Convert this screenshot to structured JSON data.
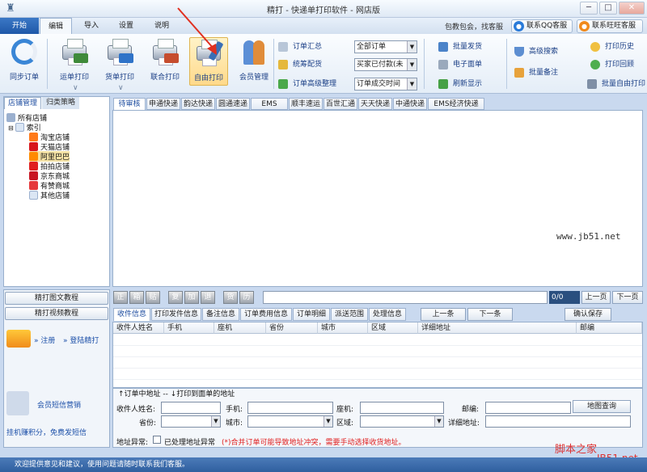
{
  "window": {
    "title": "精打 - 快递单打印软件 - 网店版",
    "min": "─",
    "max": "□",
    "close": "✕"
  },
  "menu_tabs": {
    "start": "开始",
    "edit": "编辑",
    "import": "导入",
    "settings": "设置",
    "help": "说明"
  },
  "header": {
    "promo": "包教包会，找客服",
    "qq": "联系QQ客服",
    "ww": "联系旺旺客服"
  },
  "ribbon": {
    "sync": "同步订单",
    "waybill": "运单打印",
    "invoice": "货单打印",
    "combined": "联合打印",
    "free": "自由打印",
    "member": "会员管理",
    "order_summary": "订单汇总",
    "allocate": "统筹配货",
    "adv_sort": "订单高级整理",
    "combo1": "全部订单",
    "combo2": "买家已付款(未",
    "combo3": "订单成交时间",
    "batch_ship": "批量发货",
    "e_waybill": "电子面单",
    "refresh": "刷新显示",
    "adv_search": "高级搜索",
    "batch_note": "批量备注",
    "history": "打印历史",
    "reprint": "打印回顾",
    "batch_free": "批量自由打印"
  },
  "left": {
    "tab_shop": "店铺管理",
    "tab_cat": "归类策略",
    "root": "所有店铺",
    "index": "索引",
    "shops": [
      "淘宝店铺",
      "天猫店铺",
      "阿里巴巴",
      "拍拍店铺",
      "京东商城",
      "有赞商城",
      "其他店铺"
    ],
    "btn_tutorial": "精打图文教程",
    "btn_video": "精打视频教程",
    "register": "» 注册",
    "login": "» 登陆精打",
    "sms": "会员短信营销",
    "earn": "挂机赚积分，免费发短信"
  },
  "carrier_tabs": [
    "待审核",
    "申通快递",
    "韵达快递",
    "圆通速递",
    "EMS",
    "顺丰速运",
    "百世汇通",
    "天天快递",
    "中通快递",
    "EMS经济快递"
  ],
  "watermark": "www.jb51.net",
  "toolbar2": {
    "icons": [
      "正",
      "箱",
      "贴",
      "复",
      "加",
      "退",
      "货",
      "历"
    ],
    "page": "0/0",
    "prev": "上一页",
    "next": "下一页"
  },
  "detail_tabs": [
    "收件信息",
    "打印发件信息",
    "备注信息",
    "订单费用信息",
    "订单明细",
    "派送范围",
    "处理信息"
  ],
  "detail_btns": {
    "prev": "上一条",
    "next": "下一条",
    "confirm": "确认保存"
  },
  "columns": [
    "收件人姓名",
    "手机",
    "座机",
    "省份",
    "城市",
    "区域",
    "详细地址",
    "邮编"
  ],
  "form": {
    "legend": "↑订单中地址  -- ↓打印到面单的地址",
    "name": "收件人姓名:",
    "mobile": "手机:",
    "phone": "座机:",
    "zip": "邮编:",
    "map": "地图查询",
    "province": "省份:",
    "city": "城市:",
    "district": "区域:",
    "address": "详细地址:",
    "abn": "地址异常:",
    "handled": "已处理地址异常",
    "warn": "(*)合并订单可能导致地址冲突，需要手动选择收货地址。"
  },
  "status": "欢迎提供意见和建议，使用问题请随时联系我们客服。",
  "wm_bottom1": "脚本之家",
  "wm_bottom2": "JB51.net"
}
